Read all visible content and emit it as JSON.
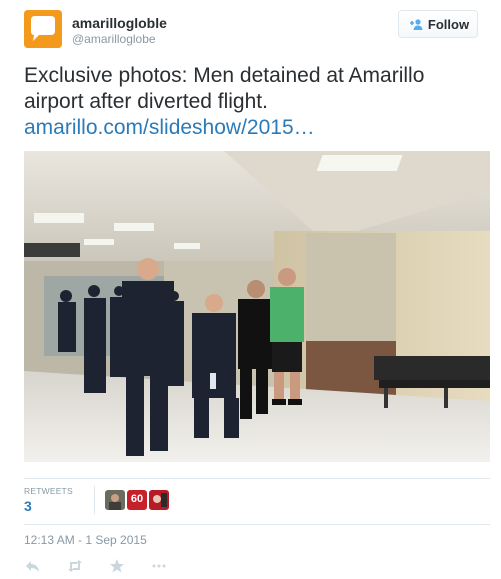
{
  "user": {
    "display_name": "amarillogloble",
    "handle": "@amarilloglobe"
  },
  "follow_button": {
    "label": "Follow"
  },
  "tweet": {
    "text": "Exclusive photos: Men detained at Amarillo airport after diverted flight.",
    "link": "amarillo.com/slideshow/2015…"
  },
  "retweets": {
    "label": "RETWEETS",
    "count": "3",
    "avatar_badge": "60"
  },
  "timestamp": "12:13 AM - 1 Sep 2015",
  "colors": {
    "link": "#2b7bb9",
    "meta": "#8899a6",
    "brand_orange": "#f39a1c"
  },
  "icons": [
    "speech-bubble-logo-icon",
    "follow-person-plus-icon",
    "reply-icon",
    "retweet-icon",
    "favorite-star-icon"
  ]
}
